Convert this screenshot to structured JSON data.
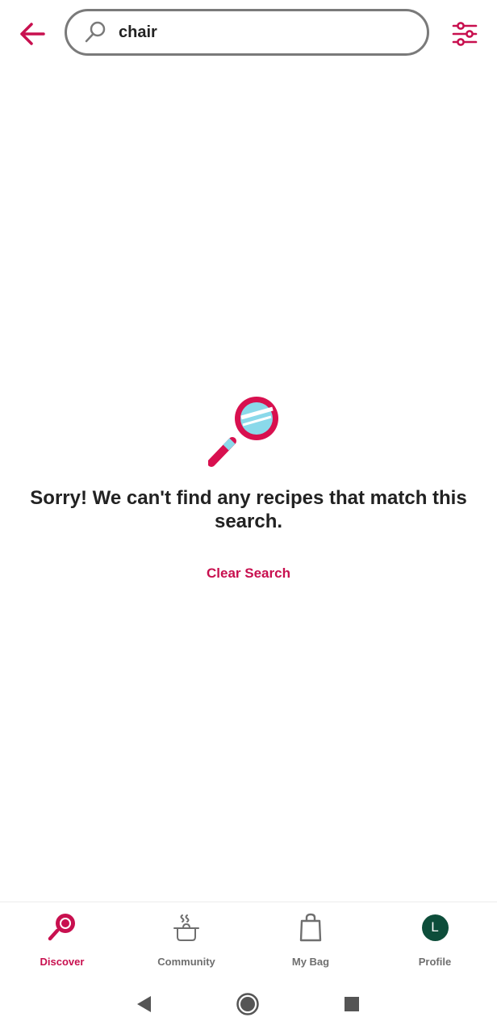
{
  "search": {
    "value": "chair",
    "placeholder": ""
  },
  "icons": {
    "back": "arrow-left-icon",
    "search": "magnifier-icon",
    "filter": "sliders-icon"
  },
  "empty_state": {
    "message": "Sorry! We can't find any recipes that match this search.",
    "clear_label": "Clear Search"
  },
  "bottom_nav": {
    "items": [
      {
        "label": "Discover",
        "icon": "magnifier-icon",
        "active": true
      },
      {
        "label": "Community",
        "icon": "pot-icon",
        "active": false
      },
      {
        "label": "My Bag",
        "icon": "shopping-bag-icon",
        "active": false
      },
      {
        "label": "Profile",
        "icon": "avatar",
        "active": false
      }
    ],
    "avatar_initial": "L"
  },
  "colors": {
    "accent": "#c8104f",
    "light_blue": "#8ad9ea",
    "avatar_bg": "#0d4d3a",
    "inactive": "#6f6f6f"
  }
}
